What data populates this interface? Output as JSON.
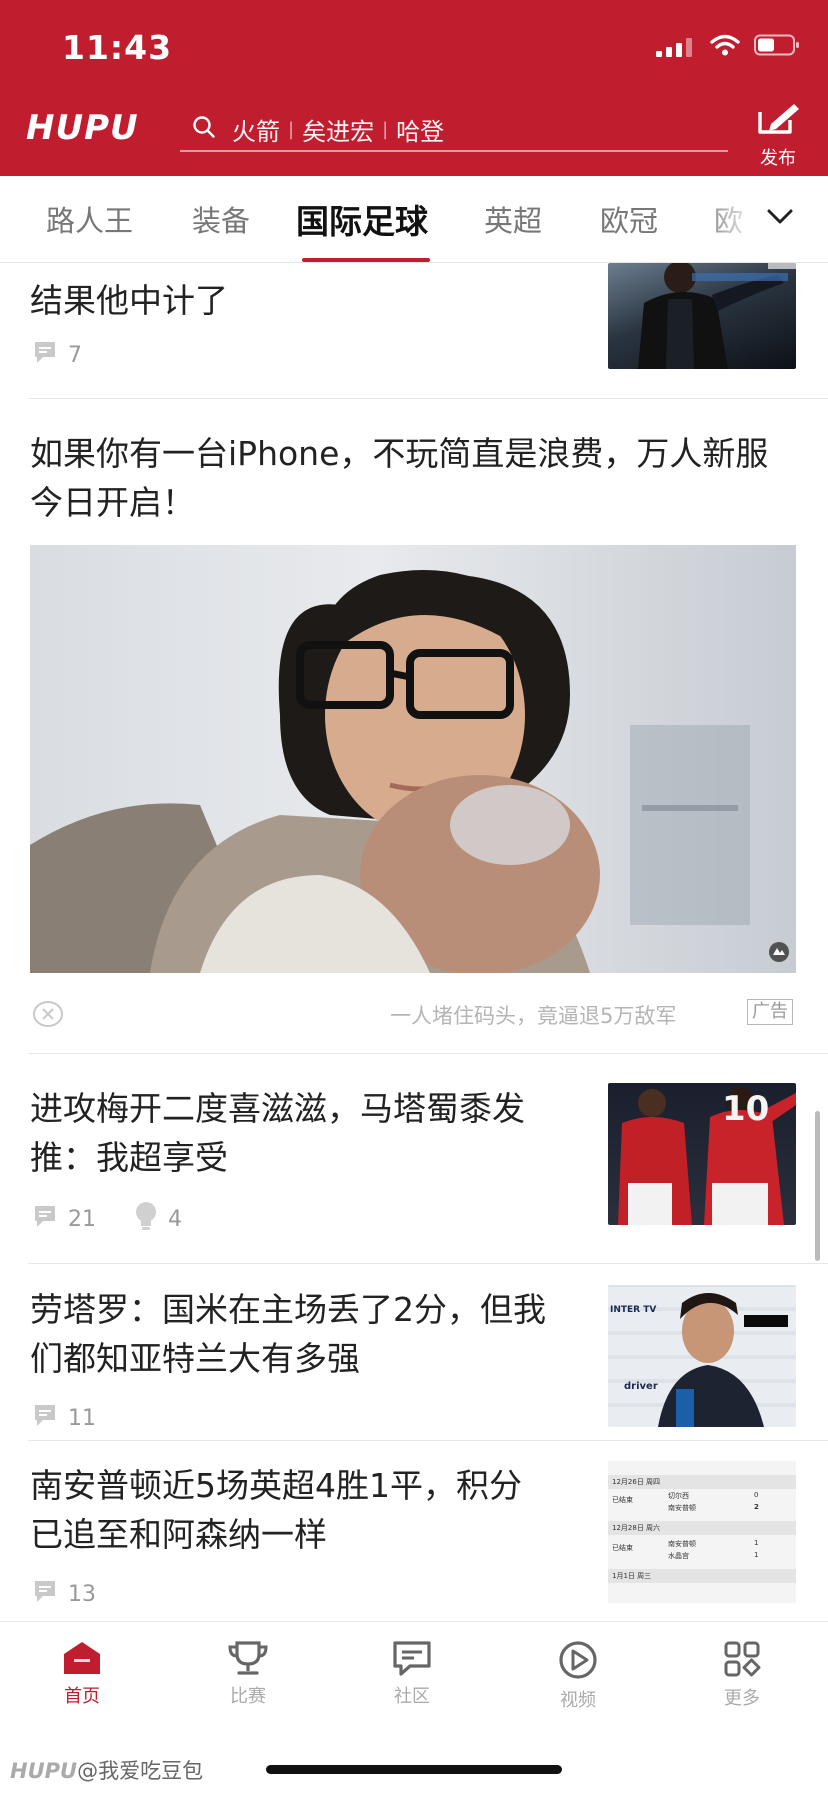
{
  "status_bar": {
    "time": "11:43"
  },
  "header": {
    "logo": "HUPU",
    "search_hot_words": [
      "火箭",
      "矣进宏",
      "哈登"
    ],
    "publish_label": "发布"
  },
  "tabs": [
    "路人王",
    "装备",
    "国际足球",
    "英超",
    "欧冠",
    "欧"
  ],
  "active_tab": "国际足球",
  "feed": {
    "item1": {
      "title": "结果他中计了",
      "comments": "7"
    },
    "ad": {
      "title_line1": "如果你有一台iPhone，不玩简直是浪费，万人新服",
      "title_line2": "今日开启！",
      "caption": "一人堵住码头，竟逼退5万敌军",
      "badge": "广告"
    },
    "item2": {
      "title_line1": "进攻梅开二度喜滋滋，马塔蜀黍发",
      "title_line2": "推：我超享受",
      "comments": "21",
      "likes": "4",
      "jersey_number": "10"
    },
    "item3": {
      "title_line1": "劳塔罗：国米在主场丢了2分，但我",
      "title_line2": "们都知亚特兰大有多强",
      "comments": "11",
      "thumb_texts": [
        "INTER TV",
        "driver"
      ]
    },
    "item4": {
      "title_line1": "南安普顿近5场英超4胜1平，积分",
      "title_line2": "已追至和阿森纳一样",
      "comments": "13",
      "thumb_rows": [
        {
          "date": "12月26日 周四"
        },
        {
          "status": "已结束",
          "team": "切尔西",
          "score": "0"
        },
        {
          "team": "南安普顿",
          "score": "2"
        },
        {
          "date": "12月28日 周六"
        },
        {
          "status": "已结束",
          "team": "南安普顿",
          "score": "1"
        },
        {
          "team": "水晶宫",
          "score": "1"
        },
        {
          "date": "1月1日 周三"
        }
      ]
    }
  },
  "bottom_nav": [
    {
      "label": "首页",
      "icon": "home-icon"
    },
    {
      "label": "比赛",
      "icon": "trophy-icon"
    },
    {
      "label": "社区",
      "icon": "community-icon"
    },
    {
      "label": "视频",
      "icon": "video-icon"
    },
    {
      "label": "更多",
      "icon": "more-grid-icon"
    }
  ],
  "watermark": {
    "brand": "HUPU",
    "handle": "@我爱吃豆包"
  },
  "colors": {
    "brand_red": "#c01d2f",
    "meta_gray": "#999999",
    "divider": "#e7e7e7"
  }
}
